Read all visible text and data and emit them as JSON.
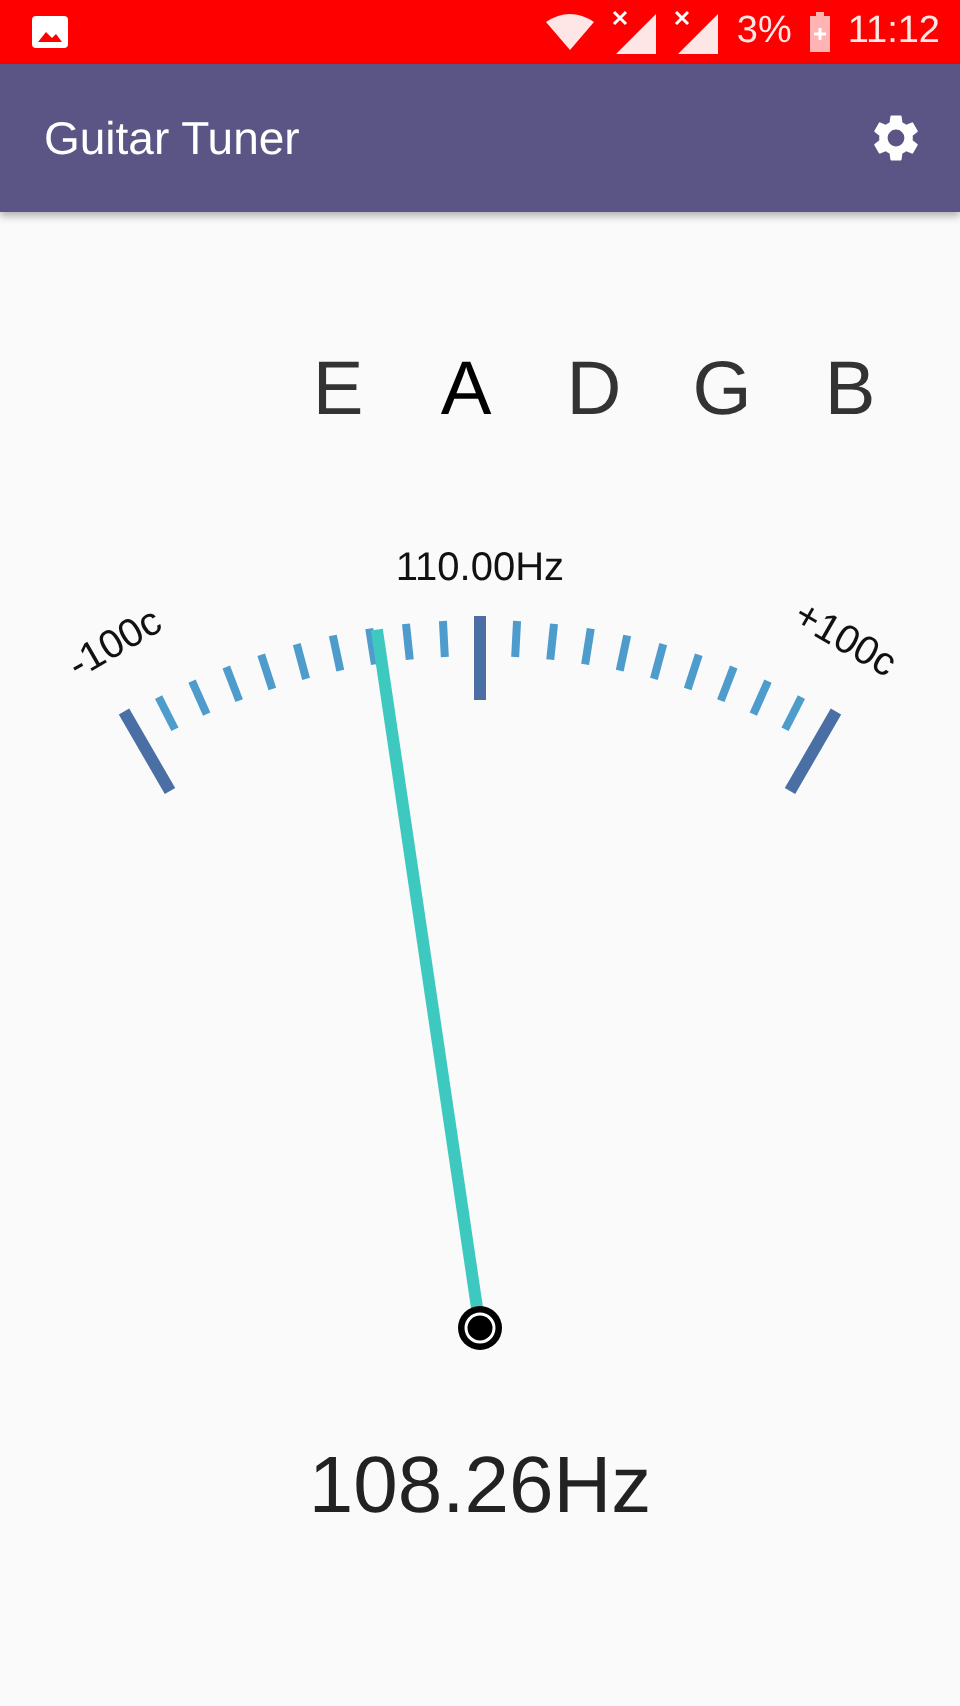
{
  "status_bar": {
    "battery": "3%",
    "time": "11:12"
  },
  "app_bar": {
    "title": "Guitar Tuner"
  },
  "strings": [
    {
      "label": "E",
      "selected": false
    },
    {
      "label": "A",
      "selected": true
    },
    {
      "label": "D",
      "selected": false
    },
    {
      "label": "G",
      "selected": false
    },
    {
      "label": "B",
      "selected": false
    }
  ],
  "gauge": {
    "target": "110.00Hz",
    "min_label": "-100c",
    "max_label": "+100c"
  },
  "reading": "108.26Hz"
}
